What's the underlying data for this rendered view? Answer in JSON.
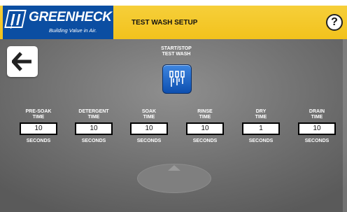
{
  "header": {
    "logo_name": "GREENHECK",
    "logo_tagline": "Building Value in Air.",
    "title": "TEST WASH SETUP",
    "help_label": "?"
  },
  "controls": {
    "back_icon": "arrow-left-icon",
    "start_stop_label": "START/STOP\nTEST WASH",
    "start_stop_icon": "spray-nozzles-icon"
  },
  "fields": [
    {
      "label": "PRE-SOAK\nTIME",
      "value": "10",
      "unit": "SECONDS"
    },
    {
      "label": "DETERGENT\nTIME",
      "value": "10",
      "unit": "SECONDS"
    },
    {
      "label": "SOAK\nTIME",
      "value": "10",
      "unit": "SECONDS"
    },
    {
      "label": "RINSE\nTIME",
      "value": "10",
      "unit": "SECONDS"
    },
    {
      "label": "DRY\nTIME",
      "value": "1",
      "unit": "SECONDS"
    },
    {
      "label": "DRAIN\nTIME",
      "value": "10",
      "unit": "SECONDS"
    }
  ],
  "colors": {
    "header_yellow": "#f2c21c",
    "brand_blue": "#0b4ea2",
    "button_blue": "#1f66c8",
    "panel_gray": "#7a7a7a"
  }
}
